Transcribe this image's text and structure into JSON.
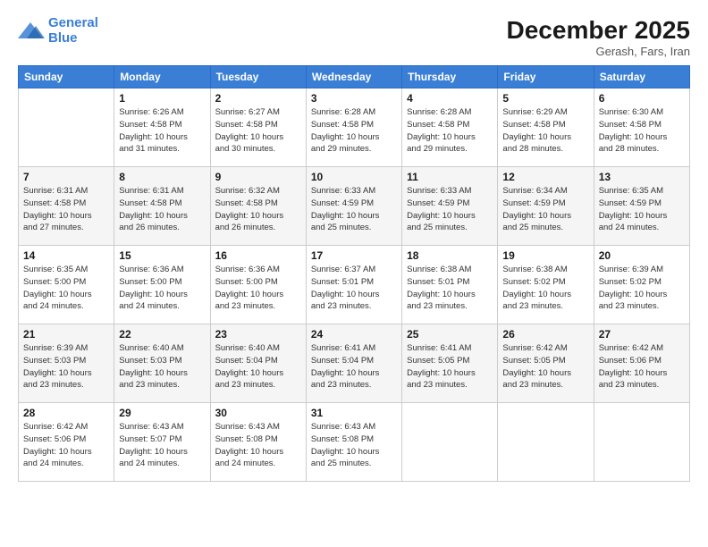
{
  "header": {
    "logo_line1": "General",
    "logo_line2": "Blue",
    "month": "December 2025",
    "location": "Gerash, Fars, Iran"
  },
  "weekdays": [
    "Sunday",
    "Monday",
    "Tuesday",
    "Wednesday",
    "Thursday",
    "Friday",
    "Saturday"
  ],
  "weeks": [
    [
      {
        "num": "",
        "info": ""
      },
      {
        "num": "1",
        "info": "Sunrise: 6:26 AM\nSunset: 4:58 PM\nDaylight: 10 hours\nand 31 minutes."
      },
      {
        "num": "2",
        "info": "Sunrise: 6:27 AM\nSunset: 4:58 PM\nDaylight: 10 hours\nand 30 minutes."
      },
      {
        "num": "3",
        "info": "Sunrise: 6:28 AM\nSunset: 4:58 PM\nDaylight: 10 hours\nand 29 minutes."
      },
      {
        "num": "4",
        "info": "Sunrise: 6:28 AM\nSunset: 4:58 PM\nDaylight: 10 hours\nand 29 minutes."
      },
      {
        "num": "5",
        "info": "Sunrise: 6:29 AM\nSunset: 4:58 PM\nDaylight: 10 hours\nand 28 minutes."
      },
      {
        "num": "6",
        "info": "Sunrise: 6:30 AM\nSunset: 4:58 PM\nDaylight: 10 hours\nand 28 minutes."
      }
    ],
    [
      {
        "num": "7",
        "info": "Sunrise: 6:31 AM\nSunset: 4:58 PM\nDaylight: 10 hours\nand 27 minutes."
      },
      {
        "num": "8",
        "info": "Sunrise: 6:31 AM\nSunset: 4:58 PM\nDaylight: 10 hours\nand 26 minutes."
      },
      {
        "num": "9",
        "info": "Sunrise: 6:32 AM\nSunset: 4:58 PM\nDaylight: 10 hours\nand 26 minutes."
      },
      {
        "num": "10",
        "info": "Sunrise: 6:33 AM\nSunset: 4:59 PM\nDaylight: 10 hours\nand 25 minutes."
      },
      {
        "num": "11",
        "info": "Sunrise: 6:33 AM\nSunset: 4:59 PM\nDaylight: 10 hours\nand 25 minutes."
      },
      {
        "num": "12",
        "info": "Sunrise: 6:34 AM\nSunset: 4:59 PM\nDaylight: 10 hours\nand 25 minutes."
      },
      {
        "num": "13",
        "info": "Sunrise: 6:35 AM\nSunset: 4:59 PM\nDaylight: 10 hours\nand 24 minutes."
      }
    ],
    [
      {
        "num": "14",
        "info": "Sunrise: 6:35 AM\nSunset: 5:00 PM\nDaylight: 10 hours\nand 24 minutes."
      },
      {
        "num": "15",
        "info": "Sunrise: 6:36 AM\nSunset: 5:00 PM\nDaylight: 10 hours\nand 24 minutes."
      },
      {
        "num": "16",
        "info": "Sunrise: 6:36 AM\nSunset: 5:00 PM\nDaylight: 10 hours\nand 23 minutes."
      },
      {
        "num": "17",
        "info": "Sunrise: 6:37 AM\nSunset: 5:01 PM\nDaylight: 10 hours\nand 23 minutes."
      },
      {
        "num": "18",
        "info": "Sunrise: 6:38 AM\nSunset: 5:01 PM\nDaylight: 10 hours\nand 23 minutes."
      },
      {
        "num": "19",
        "info": "Sunrise: 6:38 AM\nSunset: 5:02 PM\nDaylight: 10 hours\nand 23 minutes."
      },
      {
        "num": "20",
        "info": "Sunrise: 6:39 AM\nSunset: 5:02 PM\nDaylight: 10 hours\nand 23 minutes."
      }
    ],
    [
      {
        "num": "21",
        "info": "Sunrise: 6:39 AM\nSunset: 5:03 PM\nDaylight: 10 hours\nand 23 minutes."
      },
      {
        "num": "22",
        "info": "Sunrise: 6:40 AM\nSunset: 5:03 PM\nDaylight: 10 hours\nand 23 minutes."
      },
      {
        "num": "23",
        "info": "Sunrise: 6:40 AM\nSunset: 5:04 PM\nDaylight: 10 hours\nand 23 minutes."
      },
      {
        "num": "24",
        "info": "Sunrise: 6:41 AM\nSunset: 5:04 PM\nDaylight: 10 hours\nand 23 minutes."
      },
      {
        "num": "25",
        "info": "Sunrise: 6:41 AM\nSunset: 5:05 PM\nDaylight: 10 hours\nand 23 minutes."
      },
      {
        "num": "26",
        "info": "Sunrise: 6:42 AM\nSunset: 5:05 PM\nDaylight: 10 hours\nand 23 minutes."
      },
      {
        "num": "27",
        "info": "Sunrise: 6:42 AM\nSunset: 5:06 PM\nDaylight: 10 hours\nand 23 minutes."
      }
    ],
    [
      {
        "num": "28",
        "info": "Sunrise: 6:42 AM\nSunset: 5:06 PM\nDaylight: 10 hours\nand 24 minutes."
      },
      {
        "num": "29",
        "info": "Sunrise: 6:43 AM\nSunset: 5:07 PM\nDaylight: 10 hours\nand 24 minutes."
      },
      {
        "num": "30",
        "info": "Sunrise: 6:43 AM\nSunset: 5:08 PM\nDaylight: 10 hours\nand 24 minutes."
      },
      {
        "num": "31",
        "info": "Sunrise: 6:43 AM\nSunset: 5:08 PM\nDaylight: 10 hours\nand 25 minutes."
      },
      {
        "num": "",
        "info": ""
      },
      {
        "num": "",
        "info": ""
      },
      {
        "num": "",
        "info": ""
      }
    ]
  ]
}
